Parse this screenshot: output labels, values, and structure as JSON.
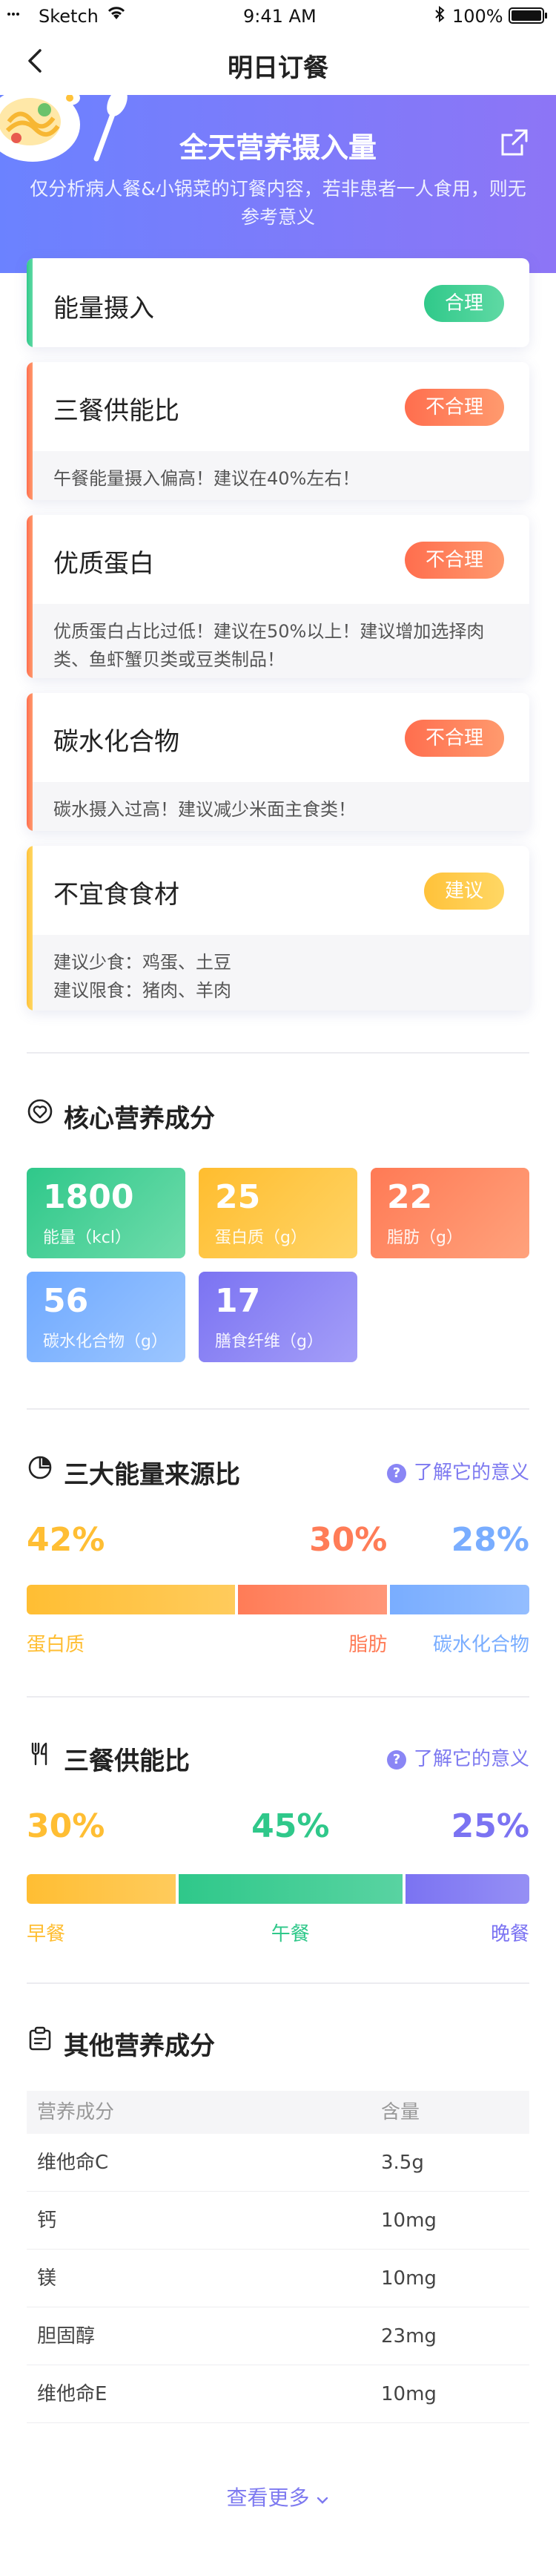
{
  "status_bar": {
    "carrier": "Sketch",
    "time": "9:41 AM",
    "battery": "100%"
  },
  "nav": {
    "title": "明日订餐"
  },
  "hero": {
    "title": "全天营养摄入量",
    "subtitle": "仅分析病人餐&小锅菜的订餐内容，若非患者一人食用，则无参考意义"
  },
  "assessments": [
    {
      "title": "能量摄入",
      "tag": "合理",
      "tone": "green",
      "note": ""
    },
    {
      "title": "三餐供能比",
      "tag": "不合理",
      "tone": "orange",
      "note": "午餐能量摄入偏高！建议在40%左右！"
    },
    {
      "title": "优质蛋白",
      "tag": "不合理",
      "tone": "orange",
      "note": "优质蛋白占比过低！建议在50%以上！建议增加选择肉类、鱼虾蟹贝类或豆类制品！"
    },
    {
      "title": "碳水化合物",
      "tag": "不合理",
      "tone": "orange",
      "note": "碳水摄入过高！建议减少米面主食类！"
    },
    {
      "title": "不宜食食材",
      "tag": "建议",
      "tone": "yellow",
      "note_line1": "建议少食：鸡蛋、土豆",
      "note_line2": "建议限食：猪肉、羊肉"
    }
  ],
  "core": {
    "title": "核心营养成分",
    "tiles": [
      {
        "value": "1800",
        "label": "能量（kcl）",
        "color1": "#2fc88a",
        "color2": "#6fdcab"
      },
      {
        "value": "25",
        "label": "蛋白质（g）",
        "color1": "#ffbd2f",
        "color2": "#ffd466"
      },
      {
        "value": "22",
        "label": "脂肪（g）",
        "color1": "#ff7a55",
        "color2": "#ffa27c"
      },
      {
        "value": "56",
        "label": "碳水化合物（g）",
        "color1": "#6fa9ff",
        "color2": "#9cc6ff"
      },
      {
        "value": "17",
        "label": "膳食纤维（g）",
        "color1": "#7b73f2",
        "color2": "#a49ef8"
      }
    ]
  },
  "energy_source": {
    "title": "三大能量来源比",
    "learn": "了解它的意义",
    "items": [
      {
        "pct": "42%",
        "fraction": 0.42,
        "label": "蛋白质",
        "color": "#ffbe33"
      },
      {
        "pct": "30%",
        "fraction": 0.3,
        "label": "脂肪",
        "color": "#ff7c57"
      },
      {
        "pct": "28%",
        "fraction": 0.28,
        "label": "碳水化合物",
        "color": "#79adff"
      }
    ]
  },
  "meal_ratio": {
    "title": "三餐供能比",
    "learn": "了解它的意义",
    "items": [
      {
        "pct": "30%",
        "fraction": 0.3,
        "label": "早餐",
        "color": "#ffbe33"
      },
      {
        "pct": "45%",
        "fraction": 0.45,
        "label": "午餐",
        "color": "#2fc88a"
      },
      {
        "pct": "25%",
        "fraction": 0.25,
        "label": "晚餐",
        "color": "#7b73f2"
      }
    ]
  },
  "other": {
    "title": "其他营养成分",
    "header": {
      "name": "营养成分",
      "amount": "含量"
    },
    "rows": [
      {
        "name": "维他命C",
        "amount": "3.5g"
      },
      {
        "name": "钙",
        "amount": "10mg"
      },
      {
        "name": "镁",
        "amount": "10mg"
      },
      {
        "name": "胆固醇",
        "amount": "23mg"
      },
      {
        "name": "维他命E",
        "amount": "10mg"
      }
    ],
    "more": "查看更多"
  }
}
